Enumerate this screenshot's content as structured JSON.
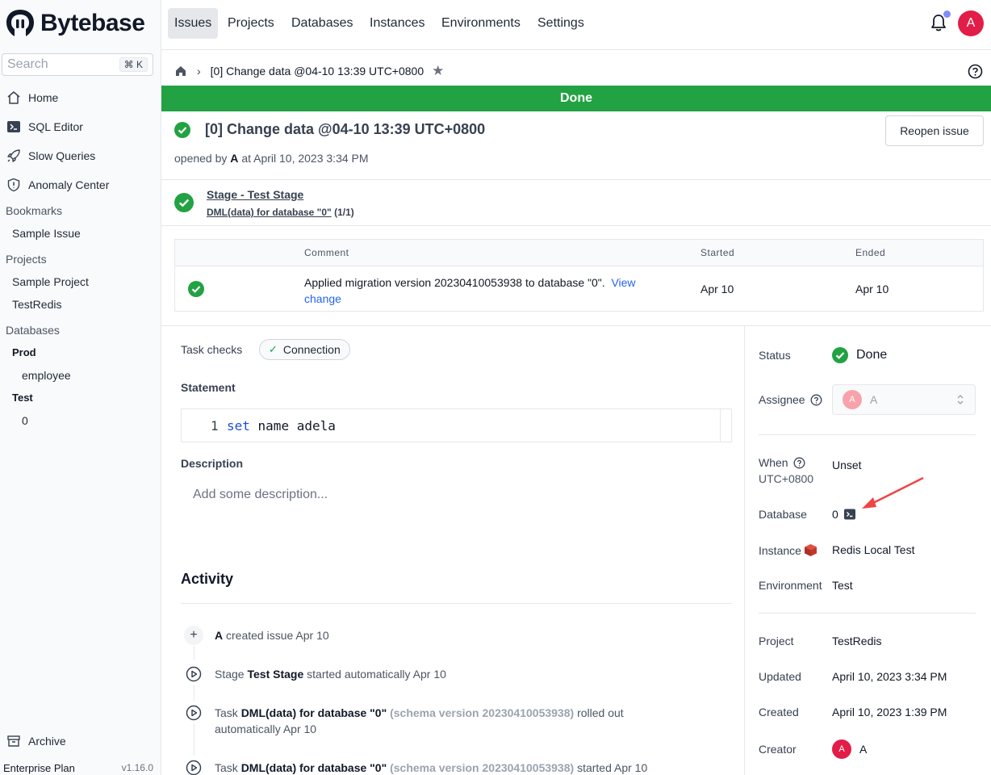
{
  "brand": {
    "name": "Bytebase"
  },
  "search": {
    "placeholder": "Search",
    "shortcut": "⌘ K"
  },
  "sidebar": {
    "nav": [
      {
        "label": "Home",
        "icon": "home-icon"
      },
      {
        "label": "SQL Editor",
        "icon": "terminal-icon"
      },
      {
        "label": "Slow Queries",
        "icon": "rocket-icon"
      },
      {
        "label": "Anomaly Center",
        "icon": "shield-icon"
      }
    ],
    "bookmarks_label": "Bookmarks",
    "bookmarks": [
      "Sample Issue"
    ],
    "projects_label": "Projects",
    "projects": [
      "Sample Project",
      "TestRedis"
    ],
    "databases_label": "Databases",
    "environments": [
      {
        "name": "Prod",
        "databases": [
          "employee"
        ]
      },
      {
        "name": "Test",
        "databases": [
          "0"
        ]
      }
    ],
    "archive": "Archive",
    "plan": "Enterprise Plan",
    "version": "v1.16.0"
  },
  "topnav": {
    "tabs": [
      "Issues",
      "Projects",
      "Databases",
      "Instances",
      "Environments",
      "Settings"
    ],
    "active_tab": "Issues",
    "avatar": "A"
  },
  "breadcrumb": {
    "current": "[0] Change data @04-10 13:39 UTC+0800"
  },
  "banner": {
    "text": "Done"
  },
  "issue": {
    "title": "[0] Change data @04-10 13:39 UTC+0800",
    "opened_prefix": "opened by",
    "opened_by": "A",
    "opened_suffix": "at April 10, 2023 3:34 PM",
    "reopen_label": "Reopen issue"
  },
  "stage": {
    "title": "Stage - Test Stage",
    "task_name": "DML(data) for database \"0\"",
    "task_count": "(1/1)"
  },
  "task_table": {
    "headers": {
      "comment": "Comment",
      "started": "Started",
      "ended": "Ended"
    },
    "row": {
      "comment": "Applied migration version 20230410053938 to database \"0\".",
      "link_1": "View",
      "link_2": "change",
      "started": "Apr 10",
      "ended": "Apr 10"
    }
  },
  "task_checks": {
    "label": "Task checks",
    "chip": "Connection"
  },
  "statement": {
    "label": "Statement",
    "line_no": "1",
    "keyword": "set",
    "rest": " name adela"
  },
  "description": {
    "label": "Description",
    "placeholder": "Add some description..."
  },
  "activity": {
    "title": "Activity",
    "items": [
      {
        "actor": "A",
        "text": "created issue Apr 10"
      },
      {
        "prefix": "Stage",
        "bold": "Test Stage",
        "text": "started automatically Apr 10"
      },
      {
        "prefix": "Task",
        "bold": "DML(data) for database \"0\"",
        "muted": "(schema version 20230410053938)",
        "text": "rolled out",
        "text2": "automatically Apr 10"
      },
      {
        "prefix": "Task",
        "bold": "DML(data) for database \"0\"",
        "muted": "(schema version 20230410053938)",
        "text": "started Apr 10"
      }
    ]
  },
  "panel": {
    "status_label": "Status",
    "status_value": "Done",
    "assignee_label": "Assignee",
    "assignee_avatar": "A",
    "assignee_value": "A",
    "when_label": "When",
    "when_tz": "UTC+0800",
    "when_value": "Unset",
    "database_label": "Database",
    "database_value": "0",
    "instance_label": "Instance",
    "instance_value": "Redis Local Test",
    "environment_label": "Environment",
    "environment_value": "Test",
    "project_label": "Project",
    "project_value": "TestRedis",
    "updated_label": "Updated",
    "updated_value": "April 10, 2023 3:34 PM",
    "created_label": "Created",
    "created_value": "April 10, 2023 1:39 PM",
    "creator_label": "Creator",
    "creator_avatar": "A",
    "creator_value": "A"
  },
  "colors": {
    "success": "#22a243",
    "link": "#2563eb",
    "avatar": "#e11d48",
    "redis": "#c0392b"
  }
}
